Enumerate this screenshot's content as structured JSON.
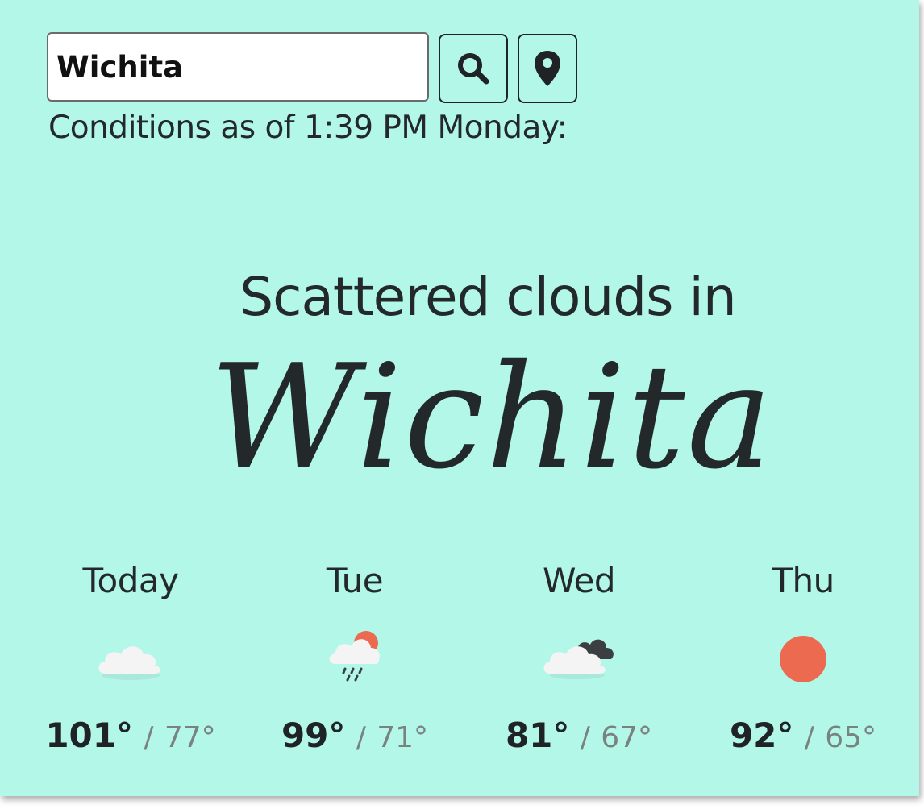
{
  "search": {
    "value": "Wichita",
    "search_icon": "search-icon",
    "location_icon": "map-pin-icon"
  },
  "conditions": "Conditions as of 1:39 PM Monday:",
  "headline": "Scattered clouds in",
  "city": "Wichita",
  "colors": {
    "background": "#b2f7e8",
    "text": "#23282b",
    "sun": "#ec6a4f",
    "cloud_light": "#f4f4f4",
    "cloud_dark": "#3c3f42"
  },
  "forecast": [
    {
      "day": "Today",
      "icon": "cloud-icon",
      "high": "101°",
      "sep": "/",
      "low": "77°"
    },
    {
      "day": "Tue",
      "icon": "rain-sun-cloud-icon",
      "high": "99°",
      "sep": "/",
      "low": "71°"
    },
    {
      "day": "Wed",
      "icon": "dark-cloud-icon",
      "high": "81°",
      "sep": "/",
      "low": "67°"
    },
    {
      "day": "Thu",
      "icon": "sun-icon",
      "high": "92°",
      "sep": "/",
      "low": "65°"
    }
  ]
}
